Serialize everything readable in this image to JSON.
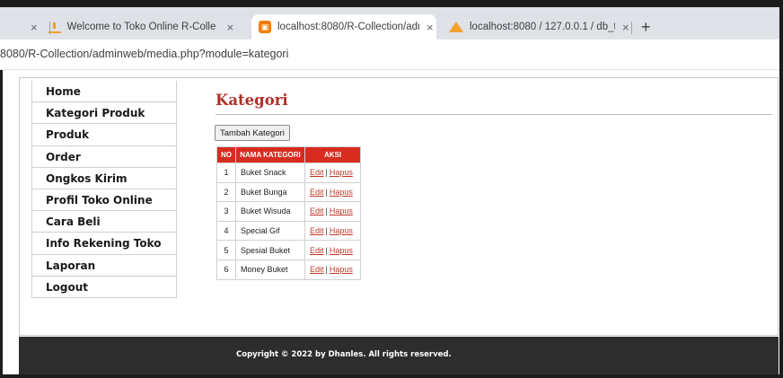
{
  "browser": {
    "tabs": [
      {
        "title": "Welcome to Toko Online R-Colle",
        "icon": "shop-favicon-icon",
        "active": false
      },
      {
        "title": "localhost:8080/R-Collection/adm",
        "icon": "localhost-favicon-icon",
        "active": true
      },
      {
        "title": "localhost:8080 / 127.0.0.1 / db_to",
        "icon": "phpmyadmin-favicon-icon",
        "active": false
      }
    ],
    "close_glyph": "×",
    "new_tab_glyph": "+",
    "url": "8080/R-Collection/adminweb/media.php?module=kategori"
  },
  "sidebar": {
    "items": [
      {
        "label": "Home"
      },
      {
        "label": "Kategori Produk"
      },
      {
        "label": "Produk"
      },
      {
        "label": "Order"
      },
      {
        "label": "Ongkos Kirim"
      },
      {
        "label": "Profil Toko Online"
      },
      {
        "label": "Cara Beli"
      },
      {
        "label": "Info Rekening Toko"
      },
      {
        "label": "Laporan"
      },
      {
        "label": "Logout"
      }
    ]
  },
  "main": {
    "title": "Kategori",
    "add_button_label": "Tambah Kategori",
    "table": {
      "headers": [
        "NO",
        "NAMA KATEGORI",
        "AKSI"
      ],
      "rows": [
        {
          "no": "1",
          "nama": "Buket Snack"
        },
        {
          "no": "2",
          "nama": "Buket Bunga"
        },
        {
          "no": "3",
          "nama": "Buket Wisuda"
        },
        {
          "no": "4",
          "nama": "Special Gif"
        },
        {
          "no": "5",
          "nama": "Spesial Buket"
        },
        {
          "no": "6",
          "nama": "Money Buket"
        }
      ],
      "edit_label": "Edit",
      "separator": "|",
      "delete_label": "Hapus"
    }
  },
  "footer": {
    "text": "Copyright © 2022 by Dhanles. All rights reserved."
  },
  "colors": {
    "accent_red": "#d72c1f",
    "heading_red": "#b03028",
    "footer_bg": "#2d2d2d"
  }
}
